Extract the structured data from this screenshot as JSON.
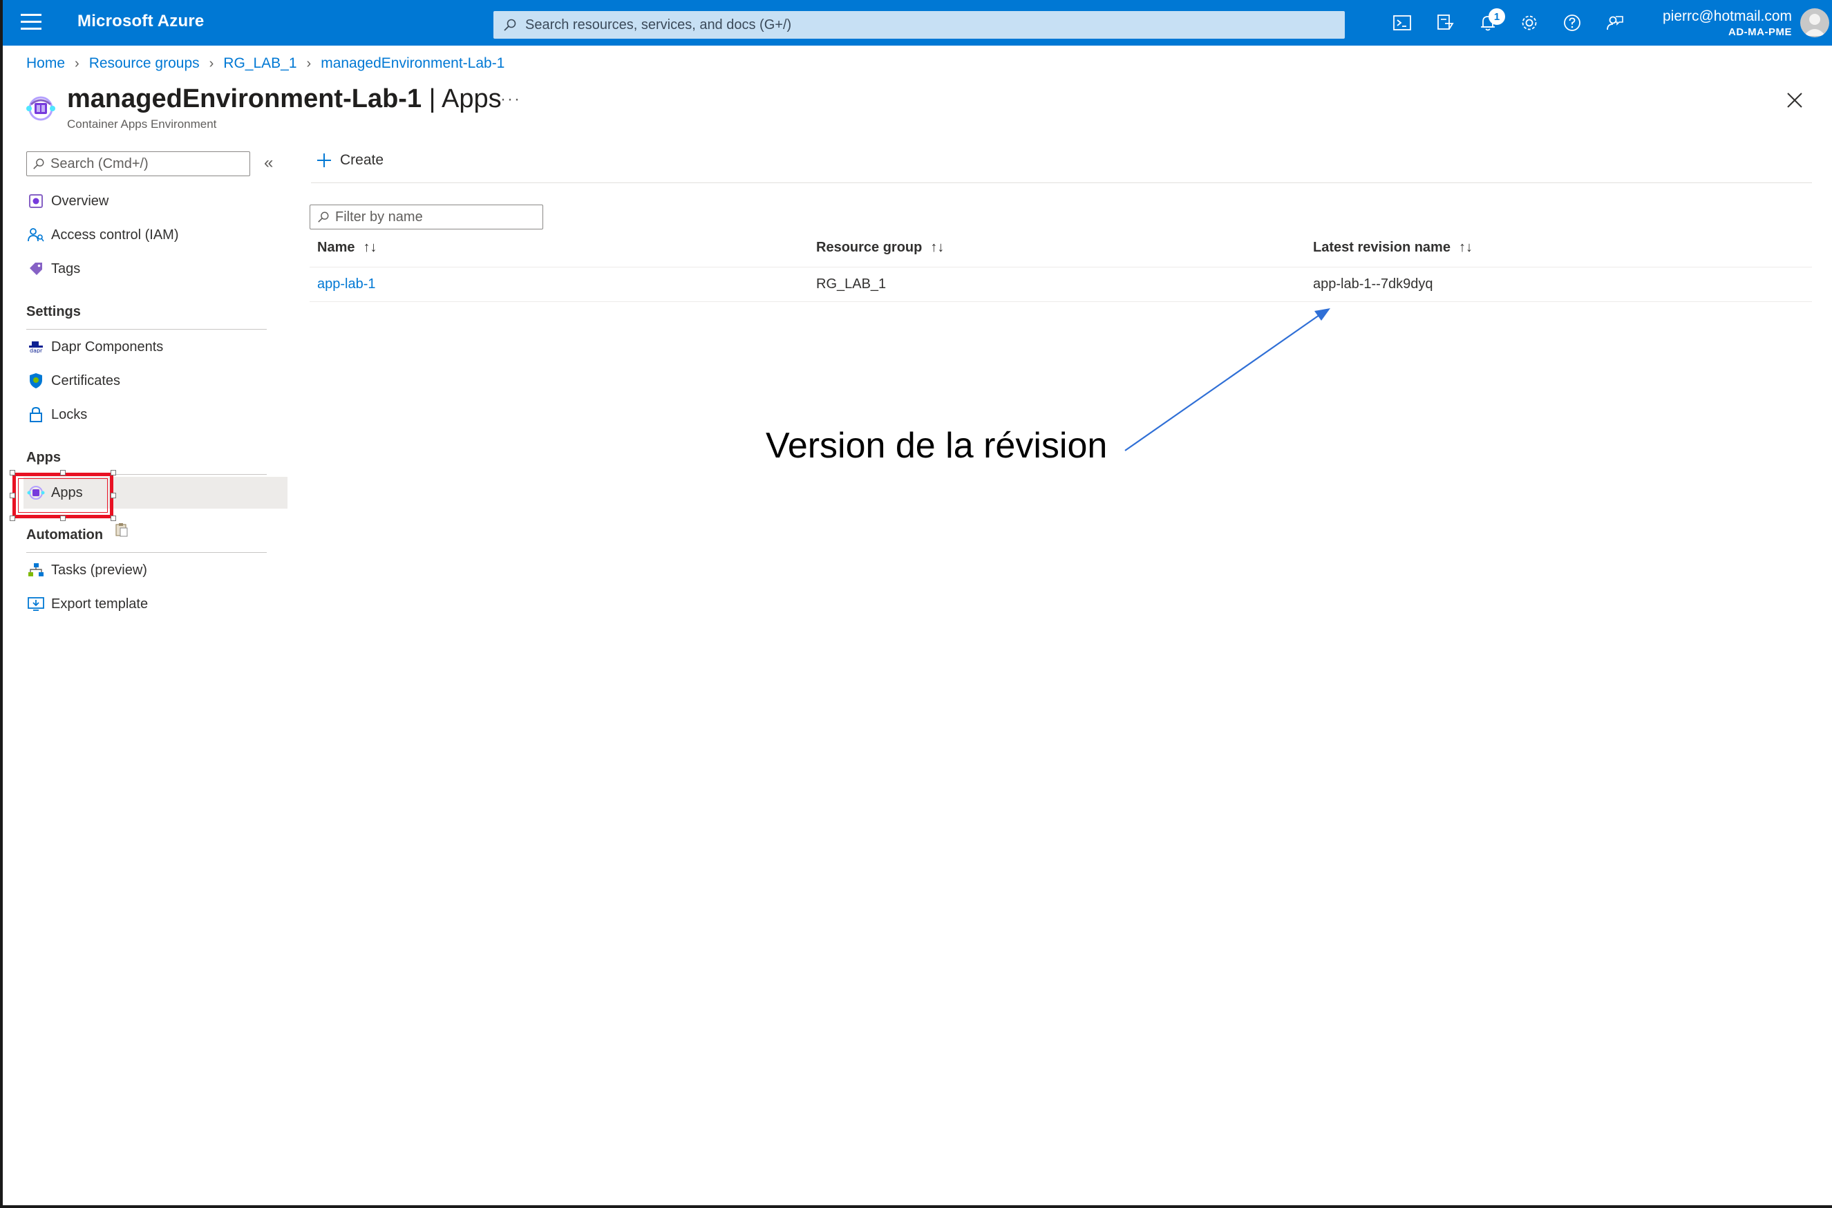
{
  "topbar": {
    "brand": "Microsoft Azure",
    "search_placeholder": "Search resources, services, and docs (G+/)",
    "notification_count": "1",
    "account_email": "pierrc@hotmail.com",
    "account_tenant": "AD-MA-PME",
    "icons": [
      "menu-icon",
      "cloud-shell-icon",
      "directory-filter-icon",
      "bell-icon",
      "gear-icon",
      "help-icon",
      "feedback-icon"
    ]
  },
  "breadcrumb": [
    "Home",
    "Resource groups",
    "RG_LAB_1",
    "managedEnvironment-Lab-1"
  ],
  "header": {
    "resource_name": "managedEnvironment-Lab-1",
    "separator": "|",
    "blade_name": "Apps",
    "subtitle": "Container Apps Environment",
    "more": "···"
  },
  "nav": {
    "search_placeholder": "Search (Cmd+/)",
    "collapse": "«",
    "items_top": [
      "Overview",
      "Access control (IAM)",
      "Tags"
    ],
    "settings_label": "Settings",
    "settings_items": [
      "Dapr Components",
      "Certificates",
      "Locks"
    ],
    "apps_label": "Apps",
    "apps_items": [
      "Apps"
    ],
    "automation_label": "Automation",
    "automation_items": [
      "Tasks (preview)",
      "Export template"
    ]
  },
  "main": {
    "create_label": "Create",
    "filter_placeholder": "Filter by name",
    "columns": [
      "Name",
      "Resource group",
      "Latest revision name"
    ],
    "sort_glyph": "↑↓",
    "rows": [
      {
        "name": "app-lab-1",
        "resource_group": "RG_LAB_1",
        "latest_revision": "app-lab-1--7dk9dyq"
      }
    ]
  },
  "annotation": {
    "text": "Version de la révision",
    "arrow_color": "#2f6fd6"
  },
  "colors": {
    "accent": "#0078d4",
    "highlight": "#e81123",
    "search_bg": "#c7e0f4"
  }
}
